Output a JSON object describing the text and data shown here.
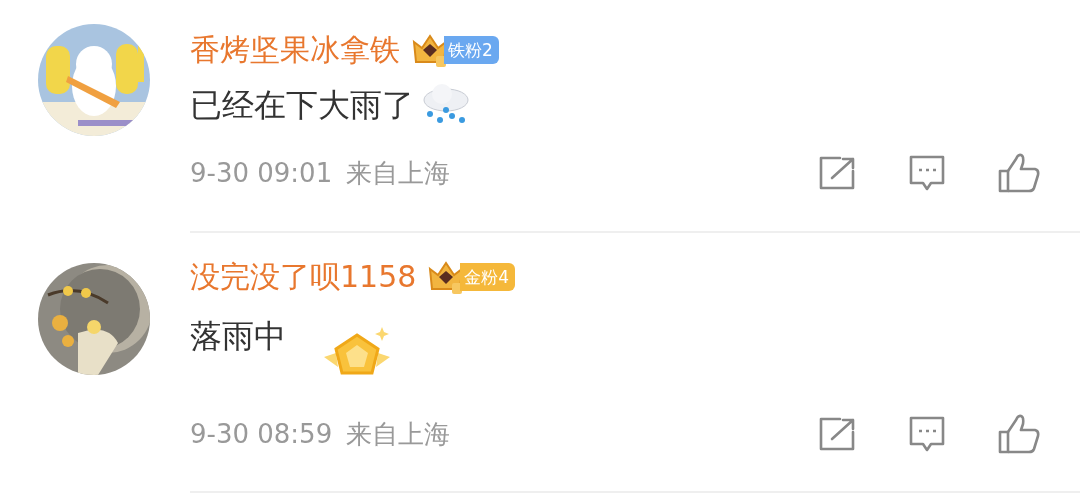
{
  "comments": [
    {
      "user_name": "香烤坚果冰拿铁",
      "fan_badge": {
        "label": "铁粉2",
        "color": "#6aa8f0"
      },
      "text": "已经在下大雨了",
      "decoration": {
        "kind": "rain-cloud"
      },
      "time": "9-30 09:01",
      "location": "来自上海"
    },
    {
      "user_name": "没完没了呗1158",
      "fan_badge": {
        "label": "金粉4",
        "color": "#f5b83a"
      },
      "text": "落雨中",
      "decoration": {
        "kind": "medal-sticker"
      },
      "time": "9-30 08:59",
      "location": "来自上海"
    }
  ]
}
